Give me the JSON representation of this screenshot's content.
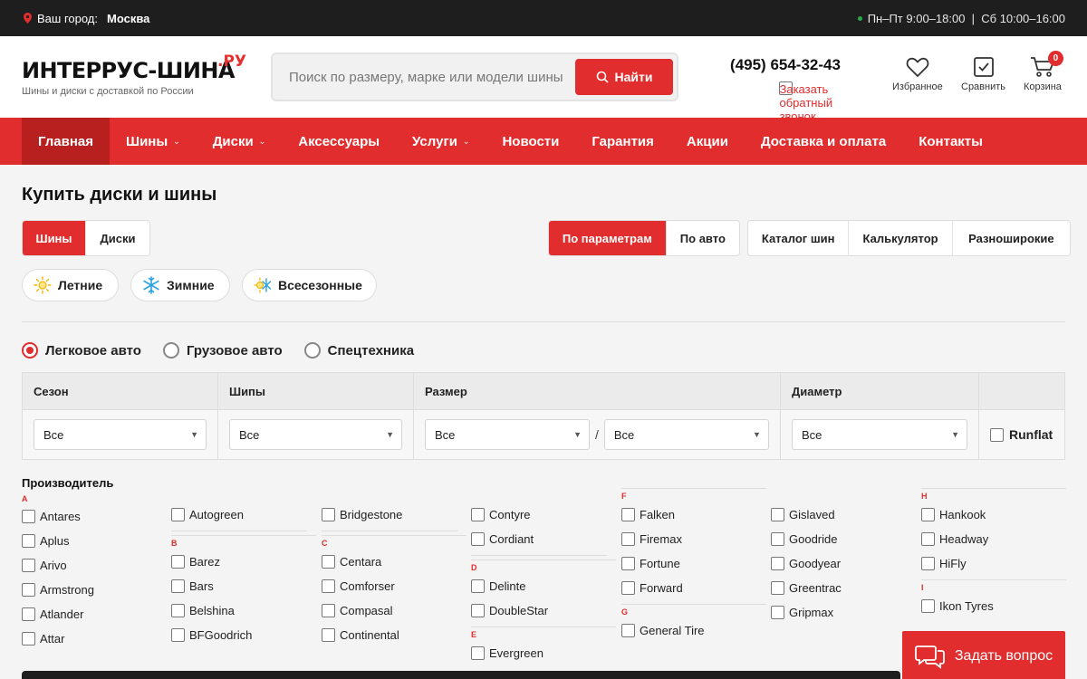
{
  "topbar": {
    "city_label": "Ваш город:",
    "city": "Москва",
    "hours": "Пн–Пт 9:00–18:00  |  Сб 10:00–16:00"
  },
  "header": {
    "logo_name": "ИНТЕРРУС-ШИНА",
    "logo_suffix": ".РУ",
    "logo_tagline": "Шины и диски с доставкой по России",
    "search_placeholder": "Поиск по размеру, марке или модели шины",
    "search_button": "Найти",
    "phone": "(495) 654-32-43",
    "callback": "Заказать обратный звонок",
    "favorites": "Избранное",
    "compare": "Сравнить",
    "cart": "Корзина",
    "cart_count": "0"
  },
  "nav": [
    {
      "label": "Главная",
      "dropdown": false
    },
    {
      "label": "Шины",
      "dropdown": true
    },
    {
      "label": "Диски",
      "dropdown": true
    },
    {
      "label": "Аксессуары",
      "dropdown": false
    },
    {
      "label": "Услуги",
      "dropdown": true
    },
    {
      "label": "Новости",
      "dropdown": false
    },
    {
      "label": "Гарантия",
      "dropdown": false
    },
    {
      "label": "Акции",
      "dropdown": false
    },
    {
      "label": "Доставка и оплата",
      "dropdown": false
    },
    {
      "label": "Контакты",
      "dropdown": false
    }
  ],
  "main": {
    "title": "Купить диски и шины",
    "product_tabs": [
      "Шины",
      "Диски"
    ],
    "mode_tabs": [
      "По параметрам",
      "По авто"
    ],
    "catalog_tabs": [
      "Каталог шин",
      "Калькулятор",
      "Разноширокие"
    ],
    "seasons": [
      "Летние",
      "Зимние",
      "Всесезонные"
    ],
    "vehicle_types": [
      "Легковое авто",
      "Грузовое авто",
      "Спецтехника"
    ],
    "filters": {
      "season_label": "Сезон",
      "season_value": "Все",
      "studs_label": "Шипы",
      "studs_value": "Все",
      "size_label": "Размер",
      "size_width_value": "Все",
      "size_separator": "/",
      "size_profile_value": "Все",
      "diameter_label": "Диаметр",
      "diameter_value": "Все",
      "runflat": "Runflat"
    },
    "manufacturer_title": "Производитель",
    "manufacturer_columns": [
      [
        {
          "letter": "A",
          "items": [
            "Antares",
            "Aplus",
            "Arivo",
            "Armstrong",
            "Atlander",
            "Attar"
          ]
        }
      ],
      [
        {
          "letter": "",
          "items": [
            "Autogreen"
          ]
        },
        {
          "letter": "B",
          "items": [
            "Barez",
            "Bars",
            "Belshina",
            "BFGoodrich"
          ]
        }
      ],
      [
        {
          "letter": "",
          "items": [
            "Bridgestone"
          ]
        },
        {
          "letter": "C",
          "items": [
            "Centara",
            "Comforser",
            "Compasal",
            "Continental"
          ]
        }
      ],
      [
        {
          "letter": "",
          "items": [
            "Contyre",
            "Cordiant"
          ]
        },
        {
          "letter": "D",
          "items": [
            "Delinte",
            "DoubleStar"
          ]
        },
        {
          "letter": "E",
          "items": [
            "Evergreen"
          ]
        }
      ],
      [
        {
          "letter": "F",
          "items": [
            "Falken",
            "Firemax",
            "Fortune",
            "Forward"
          ]
        },
        {
          "letter": "G",
          "items": [
            "General Tire"
          ]
        }
      ],
      [
        {
          "letter": "",
          "items": [
            "Gislaved",
            "Goodride",
            "Goodyear",
            "Greentrac",
            "Gripmax"
          ]
        }
      ],
      [
        {
          "letter": "H",
          "items": [
            "Hankook",
            "Headway",
            "HiFly"
          ]
        },
        {
          "letter": "I",
          "items": [
            "Ikon Tyres"
          ]
        }
      ]
    ]
  },
  "ask_button": "Задать вопрос",
  "colors": {
    "accent": "#e12d2d",
    "dark": "#1e1e1e",
    "nav_active": "#b81f1f"
  }
}
